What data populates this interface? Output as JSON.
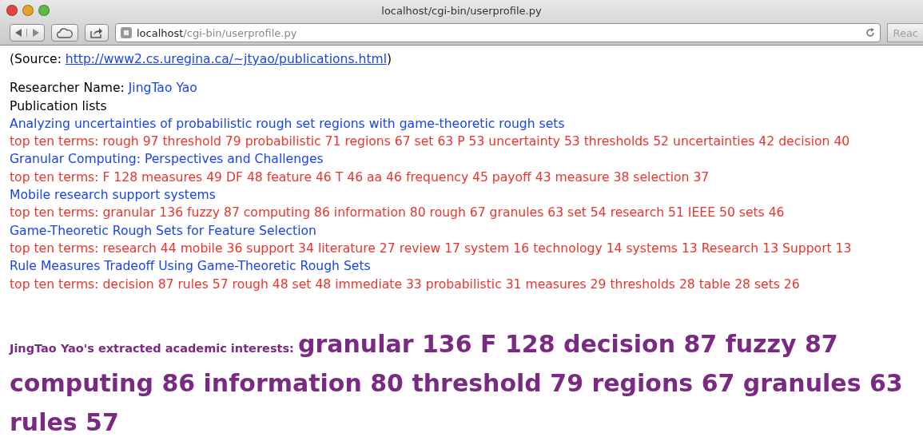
{
  "window": {
    "title": "localhost/cgi-bin/userprofile.py"
  },
  "toolbar": {
    "address_host": "localhost",
    "address_path": "/cgi-bin/userprofile.py",
    "reader_button": "Reac"
  },
  "source": {
    "label": "(Source: ",
    "link": "http://www2.cs.uregina.ca/~jtyao/publications.html",
    "close": ")"
  },
  "researcher": {
    "label": "Researcher Name: ",
    "name": "JingTao Yao"
  },
  "publications_heading": "Publication lists",
  "publications": [
    {
      "title": "Analyzing uncertainties of probabilistic rough set regions with game-theoretic rough sets",
      "terms": "top ten terms: rough 97 threshold 79 probabilistic 71 regions 67 set 63 P 53 uncertainty 53 thresholds 52 uncertainties 42 decision 40"
    },
    {
      "title": "Granular Computing: Perspectives and Challenges",
      "terms": "top ten terms: F 128 measures 49 DF 48 feature 46 T 46 aa 46 frequency 45 payoff 43 measure 38 selection 37"
    },
    {
      "title": "Mobile research support systems",
      "terms": "top ten terms: granular 136 fuzzy 87 computing 86 information 80 rough 67 granules 63 set 54 research 51 IEEE 50 sets 46"
    },
    {
      "title": "Game-Theoretic Rough Sets for Feature Selection",
      "terms": "top ten terms: research 44 mobile 36 support 34 literature 27 review 17 system 16 technology 14 systems 13 Research 13 Support 13"
    },
    {
      "title": "Rule Measures Tradeoff Using Game-Theoretic Rough Sets",
      "terms": "top ten terms: decision 87 rules 57 rough 48 set 48 immediate 33 probabilistic 31 measures 29 thresholds 28 table 28 sets 26"
    }
  ],
  "interests": {
    "label": "JingTao Yao's extracted academic interests: ",
    "terms": "granular 136 F 128 decision 87 fuzzy 87 computing 86 information 80 threshold 79 regions 67 granules 63 rules 57"
  }
}
